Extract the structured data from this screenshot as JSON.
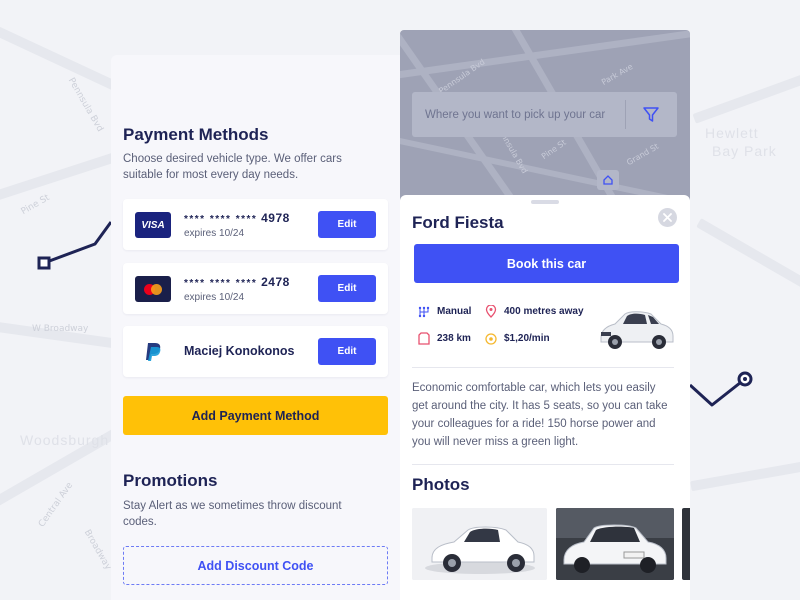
{
  "background_map": {
    "street_labels": [
      "Pennsula Bvd",
      "Pine St",
      "W Broadway",
      "Central Ave",
      "Broadway",
      "Hewlett",
      "Bay Park",
      "Woodsburgh"
    ]
  },
  "payment": {
    "title": "Payment Methods",
    "subtitle": "Choose desired vehicle type. We offer cars suitable for most every day needs.",
    "methods": [
      {
        "brand": "visa",
        "logo_text": "VISA",
        "masked": "**** **** ****",
        "last4": "4978",
        "expires": "expires 10/24",
        "edit_label": "Edit"
      },
      {
        "brand": "mastercard",
        "masked": "**** **** ****",
        "last4": "2478",
        "expires": "expires 10/24",
        "edit_label": "Edit"
      },
      {
        "brand": "paypal",
        "name": "Maciej Konokonos",
        "edit_label": "Edit"
      }
    ],
    "add_label": "Add Payment Method"
  },
  "promotions": {
    "title": "Promotions",
    "subtitle": "Stay Alert as we sometimes throw discount codes.",
    "add_code_label": "Add Discount Code"
  },
  "booking": {
    "map_labels": [
      "Pennsula Bvd",
      "Pennsula Bvd",
      "Pine St",
      "Park Ave",
      "Grand St"
    ],
    "search_placeholder": "Where you want to pick up your car",
    "car_name": "Ford Fiesta",
    "book_label": "Book this car",
    "specs": {
      "transmission": "Manual",
      "distance": "400 metres away",
      "range": "238 km",
      "price": "$1,20/min"
    },
    "description": "Economic comfortable car, which lets you easily get around the city. It has 5 seats, so you can take your colleagues for a ride! 150 horse power and you will never miss a green light.",
    "photos_title": "Photos"
  },
  "colors": {
    "primary": "#3f51f4",
    "accent_yellow": "#ffc107",
    "navy": "#1e2355",
    "muted_text": "#5a5f78",
    "location_pink": "#e8516f",
    "price_yellow": "#f5b82e"
  },
  "icons": [
    "filter-icon",
    "home-pin-icon",
    "close-icon",
    "gearbox-icon",
    "location-pin-icon",
    "fuel-icon",
    "coin-icon",
    "paypal-icon",
    "mastercard-icon"
  ]
}
